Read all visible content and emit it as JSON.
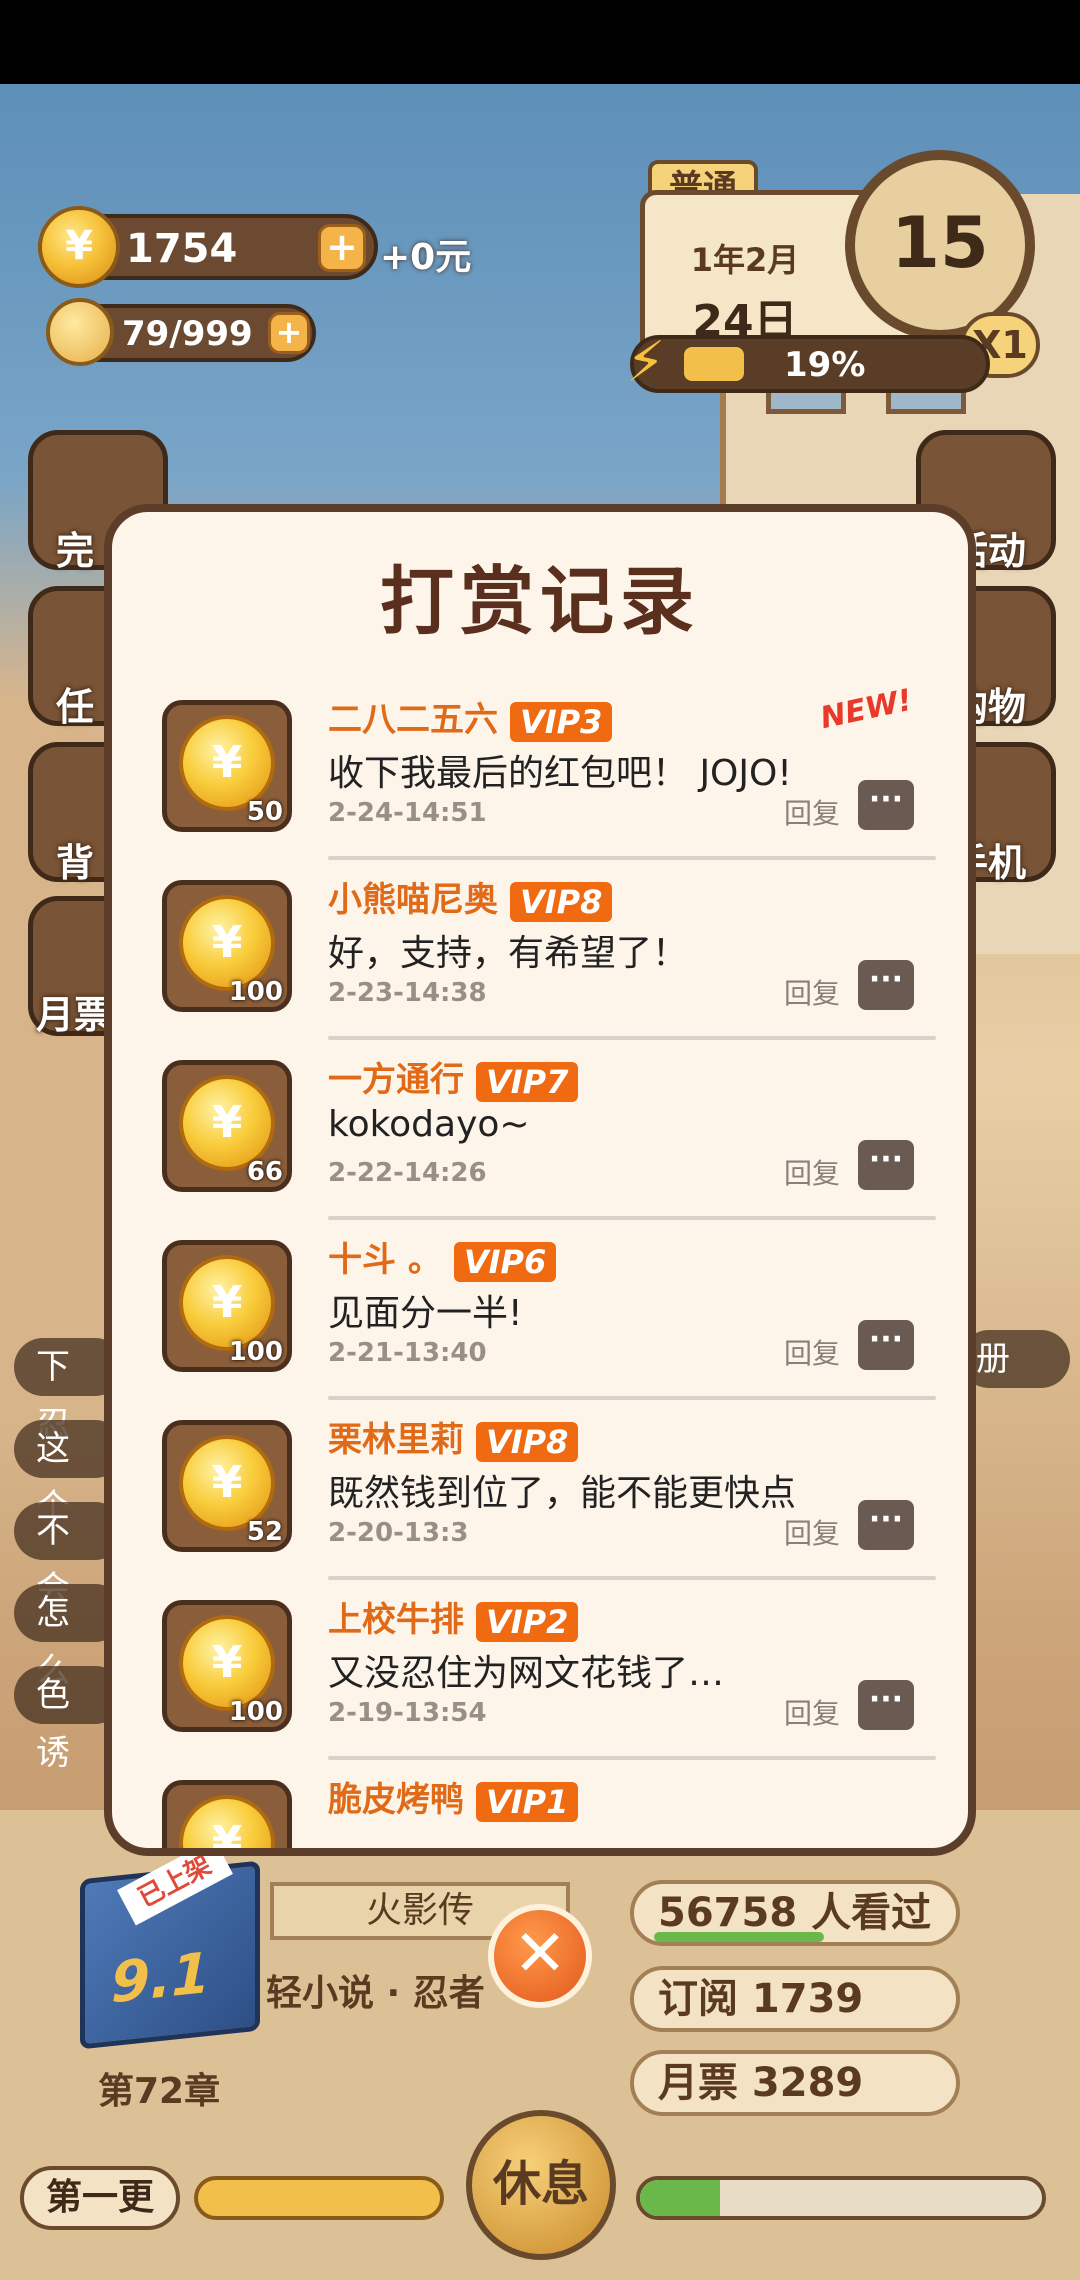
{
  "hud": {
    "coins": "1754",
    "coins_cash": "+0元",
    "energy_count": "79/999",
    "mode_tag": "普通",
    "month": "1年2月",
    "day": "24日",
    "clock_value": "15",
    "speed": "X1",
    "progress_pct": "19%"
  },
  "side_left": [
    "完",
    "任",
    "背",
    "月票"
  ],
  "side_right": [
    "活动",
    "购物",
    "手机"
  ],
  "chat_chips": [
    "下忍",
    "这个",
    "不会",
    "怎么",
    "色诱"
  ],
  "right_chip": "册",
  "modal": {
    "title": "打赏记录",
    "new_badge": "NEW!",
    "reply_label": "回复",
    "reply_icon": "···",
    "entries": [
      {
        "name": "二八二五六",
        "vip": "VIP3",
        "msg": "收下我最后的红包吧！ JOJO!",
        "time": "2-24-14:51",
        "amount": "50"
      },
      {
        "name": "小熊喵尼奥",
        "vip": "VIP8",
        "msg": "好，支持，有希望了！",
        "time": "2-23-14:38",
        "amount": "100"
      },
      {
        "name": "一方通行",
        "vip": "VIP7",
        "msg": "kokodayo~",
        "time": "2-22-14:26",
        "amount": "66"
      },
      {
        "name": "十斗 。",
        "vip": "VIP6",
        "msg": "见面分一半!",
        "time": "2-21-13:40",
        "amount": "100"
      },
      {
        "name": "栗林里莉",
        "vip": "VIP8",
        "msg": "既然钱到位了，能不能更快点",
        "time": "2-20-13:3",
        "amount": "52"
      },
      {
        "name": "上校牛排",
        "vip": "VIP2",
        "msg": "又没忍住为网文花钱了…",
        "time": "2-19-13:54",
        "amount": "100"
      },
      {
        "name": "脆皮烤鸭",
        "vip": "VIP1",
        "msg": "",
        "time": "",
        "amount": ""
      }
    ]
  },
  "book": {
    "shelf_tag": "已上架",
    "score": "9.1",
    "title": "火影传",
    "genre": "轻小说 · 忍者",
    "chapter": "第72章",
    "viewers": "56758 人看过",
    "subs": "订阅 1739",
    "monthly": "月票 3289",
    "update_btn": "第一更",
    "rest_btn": "休息",
    "close_icon": "✕"
  },
  "colors": {
    "accent": "#e06a17",
    "vip_bg": "#f06a12",
    "frame": "#5c3d2a"
  }
}
